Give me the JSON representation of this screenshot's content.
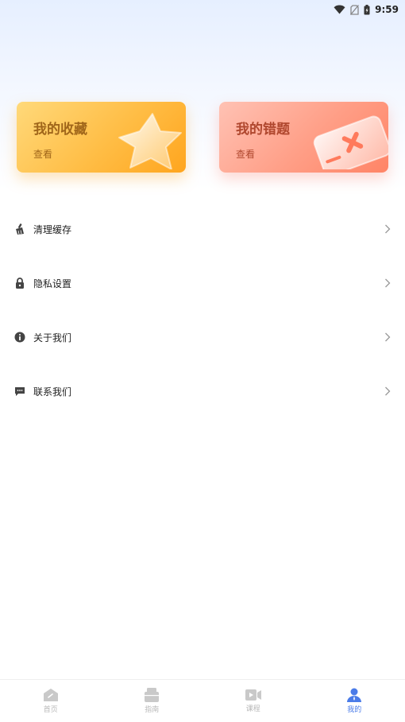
{
  "status_bar": {
    "time": "9:59"
  },
  "cards": {
    "favorites": {
      "title": "我的收藏",
      "action": "查看"
    },
    "mistakes": {
      "title": "我的错题",
      "action": "查看"
    }
  },
  "menu": [
    {
      "label": "清理缓存",
      "icon": "broom-icon"
    },
    {
      "label": "隐私设置",
      "icon": "lock-icon"
    },
    {
      "label": "关于我们",
      "icon": "info-icon"
    },
    {
      "label": "联系我们",
      "icon": "message-icon"
    }
  ],
  "tabbar": [
    {
      "label": "首页",
      "icon": "home-icon",
      "active": false
    },
    {
      "label": "指南",
      "icon": "guide-icon",
      "active": false
    },
    {
      "label": "课程",
      "icon": "video-icon",
      "active": false
    },
    {
      "label": "我的",
      "icon": "user-icon",
      "active": true
    }
  ],
  "colors": {
    "accent": "#4a7be8",
    "favorites_card": "#ffb840",
    "mistakes_card": "#ff9a82",
    "text_primary": "#222222",
    "tab_inactive": "#b8b8b8"
  }
}
